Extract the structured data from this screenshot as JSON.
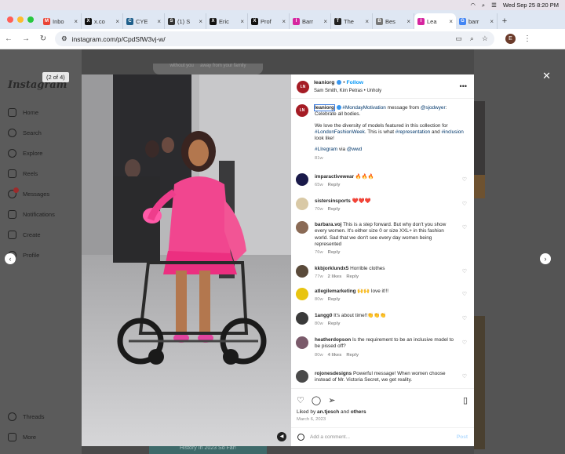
{
  "menubar": {
    "datetime": "Wed Sep 25  8:20 PM"
  },
  "tabs": [
    {
      "label": "Inbo",
      "color": "#ea4335",
      "icon": "gmail-icon",
      "glyph": "M",
      "active": false
    },
    {
      "label": "x.co",
      "color": "#111111",
      "icon": "x-icon",
      "glyph": "X",
      "active": false
    },
    {
      "label": "CYE",
      "color": "#1f5f8b",
      "icon": "cye-icon",
      "glyph": "C",
      "active": false
    },
    {
      "label": "(1) S",
      "color": "#333333",
      "icon": "substack-icon",
      "glyph": "S",
      "active": false
    },
    {
      "label": "Eric",
      "color": "#111111",
      "icon": "x-icon",
      "glyph": "X",
      "active": false
    },
    {
      "label": "Prof",
      "color": "#111111",
      "icon": "x-icon",
      "glyph": "X",
      "active": false
    },
    {
      "label": "Barr",
      "color": "#d6249f",
      "icon": "instagram-icon",
      "glyph": "I",
      "active": false
    },
    {
      "label": "The",
      "color": "#222222",
      "icon": "nyt-icon",
      "glyph": "T",
      "active": false
    },
    {
      "label": "Bes",
      "color": "#777777",
      "icon": "page-icon",
      "glyph": "B",
      "active": false
    },
    {
      "label": "Lea",
      "color": "#d6249f",
      "icon": "instagram-icon",
      "glyph": "I",
      "active": true
    },
    {
      "label": "barr",
      "color": "#4285f4",
      "icon": "google-icon",
      "glyph": "G",
      "active": false
    }
  ],
  "address": {
    "url": "instagram.com/p/CpdSfW3vj-w/"
  },
  "profile_initial": "E",
  "sidebar": {
    "logo": "Instagram",
    "items": [
      {
        "label": "Home",
        "icon": "home-icon"
      },
      {
        "label": "Search",
        "icon": "search-icon"
      },
      {
        "label": "Explore",
        "icon": "compass-icon"
      },
      {
        "label": "Reels",
        "icon": "reels-icon"
      },
      {
        "label": "Messages",
        "icon": "messenger-icon"
      },
      {
        "label": "Notifications",
        "icon": "heart-icon"
      },
      {
        "label": "Create",
        "icon": "plus-square-icon"
      },
      {
        "label": "Profile",
        "icon": "avatar-icon"
      },
      {
        "label": "Threads",
        "icon": "threads-icon"
      },
      {
        "label": "More",
        "icon": "menu-icon"
      }
    ]
  },
  "background": {
    "top_text_left": "without you",
    "top_text_right": "away from your family",
    "bottom_text": "History In 2023 So Far!"
  },
  "modal": {
    "counter": "(2 of 4)",
    "post": {
      "username": "leaniorg",
      "follow": "Follow",
      "audio": "Sam Smith, Kim Petras • Unholy",
      "avatar_text": "I.N",
      "caption": {
        "username": "leaniorg",
        "line1_tag": "#MondayMotivation",
        "line1_mid": " message from ",
        "line1_mention": "@sjodwyer",
        "line1_end": ": Celebrate all bodies.",
        "para2_a": "We love the diversity of models featured in this collection for ",
        "para2_tag1": "#LondonFashionWeek",
        "para2_b": ". This is what ",
        "para2_tag2": "#representation",
        "para2_c": " and ",
        "para2_tag3": "#inclusion",
        "para2_d": " look like!",
        "para3_tag": "#LIregram",
        "para3_mid": " via ",
        "para3_mention": "@wwd",
        "time": "81w"
      },
      "comments": [
        {
          "user": "imparactivewear",
          "text": "🔥🔥🔥",
          "time": "65w",
          "likes": "",
          "reply": "Reply",
          "avatar_color": "#1a1a4a"
        },
        {
          "user": "sistersinsports",
          "text": "❤️❤️❤️",
          "time": "70w",
          "likes": "",
          "reply": "Reply",
          "avatar_color": "#d9c9a6"
        },
        {
          "user": "barbara.voj",
          "text": "This is a step forward. But why don't you show every women. It's either size 0 or size XXL+ in this fashion world. Sad that we don't see every day women being represented",
          "time": "76w",
          "likes": "",
          "reply": "Reply",
          "avatar_color": "#8a6a55"
        },
        {
          "user": "kkbjorklundx5",
          "text": "Horrible clothes",
          "time": "77w",
          "likes": "2 likes",
          "reply": "Reply",
          "avatar_color": "#5a4a3a"
        },
        {
          "user": "atlegilemarketing",
          "text": "🙌🙌 love it!!!",
          "time": "80w",
          "likes": "",
          "reply": "Reply",
          "avatar_color": "#e8c410"
        },
        {
          "user": "1angg0",
          "text": "It's about time!!👏👏👏",
          "time": "80w",
          "likes": "",
          "reply": "Reply",
          "avatar_color": "#3a3a3a"
        },
        {
          "user": "heatherdopson",
          "text": "Is the requirement to be an inclusive model to be pissed off?",
          "time": "80w",
          "likes": "4 likes",
          "reply": "Reply",
          "avatar_color": "#7a5a6a"
        },
        {
          "user": "rojonesdesigns",
          "text": "Powerful message! When women choose instead of Mr. Victoria Secret, we get reality.",
          "time": "",
          "likes": "",
          "reply": "",
          "avatar_color": "#4a4a4a"
        }
      ],
      "liked_by_prefix": "Liked by ",
      "liked_by_user": "an.tjesch",
      "liked_by_mid": " and ",
      "liked_by_others": "others",
      "date": "March 6, 2023",
      "add_comment_placeholder": "Add a comment...",
      "post_label": "Post"
    }
  }
}
